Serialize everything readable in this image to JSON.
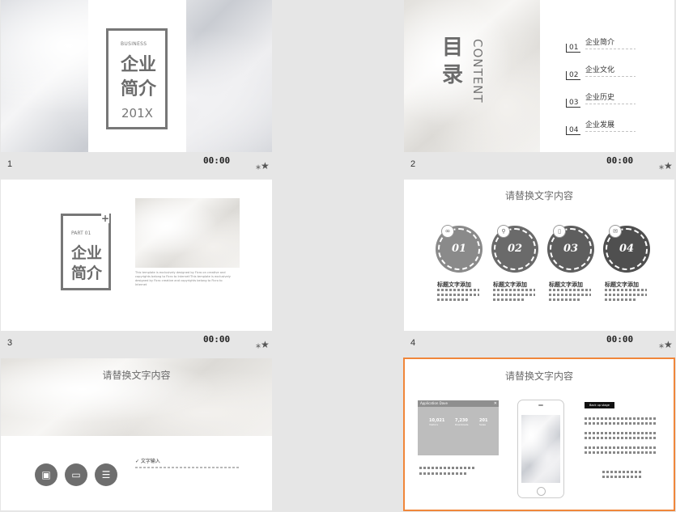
{
  "slides": [
    {
      "number": "1",
      "time": "00:00",
      "business": "BUSINESS",
      "title_line1": "企业",
      "title_line2": "简介",
      "year": "201X"
    },
    {
      "number": "2",
      "time": "00:00",
      "title_a": "目",
      "title_b": "录",
      "content_word": "CONTENT",
      "items": [
        {
          "num": "01",
          "label": "企业简介"
        },
        {
          "num": "02",
          "label": "企业文化"
        },
        {
          "num": "03",
          "label": "企业历史"
        },
        {
          "num": "04",
          "label": "企业发展"
        }
      ]
    },
    {
      "number": "3",
      "time": "00:00",
      "part": "PART 01",
      "title_line1": "企业",
      "title_line2": "简介",
      "plus": "+",
      "body": "This template is exclusively designed by Ficro on creative and copyrights belong to Ficro to Internet!This template is exclusively designed by Ficro creative and copyrights belong to Ficro to Internet"
    },
    {
      "number": "4",
      "time": "00:00",
      "heading": "请替换文字内容",
      "steps": [
        {
          "num": "01",
          "label": "标题文字添加",
          "icon": "link-icon"
        },
        {
          "num": "02",
          "label": "标题文字添加",
          "icon": "bike-icon"
        },
        {
          "num": "03",
          "label": "标题文字添加",
          "icon": "document-icon"
        },
        {
          "num": "04",
          "label": "标题文字添加",
          "icon": "mail-icon"
        }
      ]
    },
    {
      "number": "",
      "time": "",
      "heading": "请替换文字内容",
      "check_label": "✓  文字输入"
    },
    {
      "number": "",
      "time": "",
      "heading": "请替换文字内容",
      "app_title": "Application Dave",
      "stats": [
        {
          "value": "10,021",
          "label": "Visitors"
        },
        {
          "value": "7,230",
          "label": "Downloads"
        },
        {
          "value": "201",
          "label": "Sales"
        }
      ],
      "badge": "Back up stage"
    }
  ],
  "colors": {
    "selected_border": "#f0863a",
    "gray_dark": "#616161",
    "gray_mid": "#8a8a8a"
  }
}
